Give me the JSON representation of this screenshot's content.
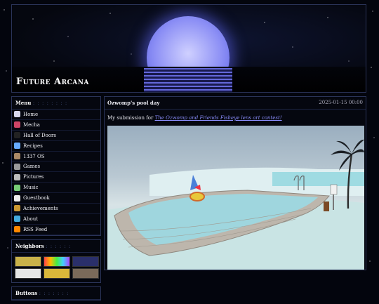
{
  "site": {
    "title": "Future Arcana"
  },
  "menu": {
    "heading": "Menu",
    "items": [
      {
        "label": "Home",
        "icon": "moon-icon",
        "color": "#d8d8f0"
      },
      {
        "label": "Mecha",
        "icon": "robot-icon",
        "color": "#c46"
      },
      {
        "label": "Hall of Doors",
        "icon": "door-icon",
        "color": "#222"
      },
      {
        "label": "Recipes",
        "icon": "flask-icon",
        "color": "#6af"
      },
      {
        "label": "1337 OS",
        "icon": "computer-icon",
        "color": "#a86"
      },
      {
        "label": "Games",
        "icon": "gamepad-icon",
        "color": "#999"
      },
      {
        "label": "Pictures",
        "icon": "camera-icon",
        "color": "#bbb"
      },
      {
        "label": "Music",
        "icon": "music-icon",
        "color": "#7c7"
      },
      {
        "label": "Guestbook",
        "icon": "envelope-icon",
        "color": "#eee"
      },
      {
        "label": "Achievements",
        "icon": "trophy-icon",
        "color": "#c93"
      },
      {
        "label": "About",
        "icon": "diamond-icon",
        "color": "#4ad"
      },
      {
        "label": "RSS Feed",
        "icon": "rss-icon",
        "color": "#f80"
      }
    ]
  },
  "neighbors": {
    "heading": "Neighbors",
    "buttons": [
      {
        "name": "neighbor-button-1",
        "bg": "#c9b24a"
      },
      {
        "name": "neighbor-button-2",
        "bg": "linear-gradient(90deg,#f44,#fb0,#4e4,#4cf,#a4f)"
      },
      {
        "name": "neighbor-button-3",
        "bg": "#2a2f6a"
      },
      {
        "name": "neighbor-button-4",
        "bg": "#e6e6e6"
      },
      {
        "name": "neighbor-button-5",
        "bg": "#d9b73a"
      },
      {
        "name": "neighbor-button-6",
        "bg": "#7a6a5a"
      }
    ]
  },
  "buttons_box": {
    "heading": "Buttons"
  },
  "post": {
    "title": "Ozwomp's pool day",
    "date": "2025-01-15 00:00",
    "intro_prefix": "My submission for ",
    "intro_link": "The Ozwomp and Friends Fisheye lens art contest!"
  },
  "colors": {
    "border": "#2a3358",
    "link": "#8c8fff",
    "moon": "#8c8ff5"
  }
}
